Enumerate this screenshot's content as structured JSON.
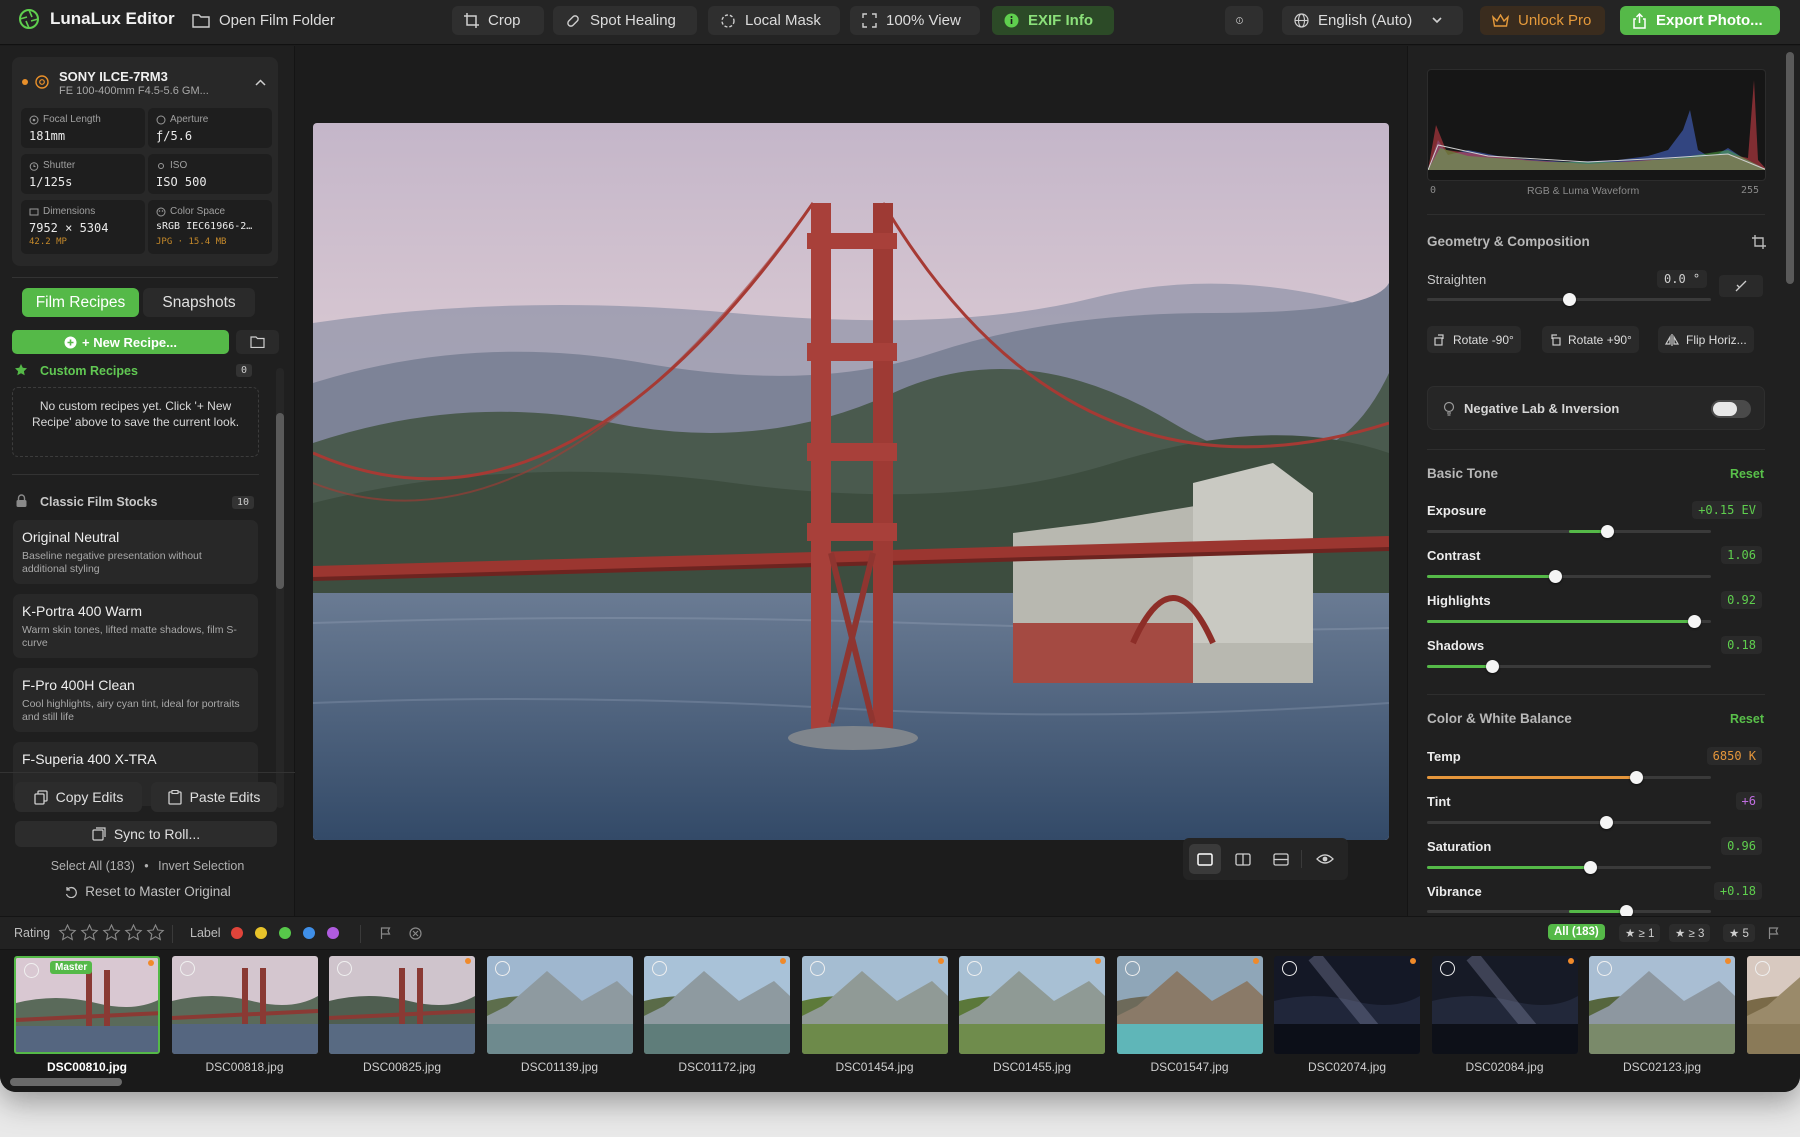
{
  "app": {
    "name": "LunaLux Editor"
  },
  "toolbar": {
    "open_folder": "Open Film Folder",
    "crop": "Crop",
    "spot_healing": "Spot Healing",
    "local_mask": "Local Mask",
    "view": "100% View",
    "exif": "EXIF Info",
    "language": "English (Auto)",
    "unlock": "Unlock Pro",
    "export": "Export Photo..."
  },
  "camera": {
    "model": "SONY ILCE-7RM3",
    "lens": "FE 100-400mm F4.5-5.6 GM...",
    "exif": {
      "focal_label": "Focal Length",
      "focal": "181mm",
      "aperture_label": "Aperture",
      "aperture": "ƒ/5.6",
      "shutter_label": "Shutter",
      "shutter": "1/125s",
      "iso_label": "ISO",
      "iso": "ISO 500",
      "dim_label": "Dimensions",
      "dim": "7952 × 5304",
      "mp": "42.2 MP",
      "cs_label": "Color Space",
      "cs": "sRGB IEC61966-2…",
      "file": "JPG · 15.4 MB"
    }
  },
  "left": {
    "tab_recipes": "Film Recipes",
    "tab_snapshots": "Snapshots",
    "new_recipe": "+ New Recipe...",
    "custom_title": "Custom Recipes",
    "custom_count": "0",
    "custom_empty": "No custom recipes yet. Click '+ New Recipe' above to save the current look.",
    "classic_title": "Classic Film Stocks",
    "classic_count": "10",
    "recipes": [
      {
        "title": "Original Neutral",
        "desc": "Baseline negative presentation without additional styling"
      },
      {
        "title": "K-Portra 400 Warm",
        "desc": "Warm skin tones, lifted matte shadows, film S-curve"
      },
      {
        "title": "F-Pro 400H Clean",
        "desc": "Cool highlights, airy cyan tint, ideal for portraits and still life"
      },
      {
        "title": "F-Superia 400 X-TRA",
        "desc": ""
      }
    ],
    "copy_edits": "Copy Edits",
    "paste_edits": "Paste Edits",
    "sync": "Sync to Roll...",
    "select_all": "Select All (183)",
    "invert": "Invert Selection",
    "reset_master": "Reset to Master Original"
  },
  "right": {
    "histogram_min": "0",
    "histogram_label": "RGB & Luma Waveform",
    "histogram_max": "255",
    "geometry_title": "Geometry & Composition",
    "straighten_label": "Straighten",
    "straighten_value": "0.0 °",
    "straighten_level": 0.5,
    "rotate_left": "Rotate -90°",
    "rotate_right": "Rotate +90°",
    "flip": "Flip Horiz...",
    "negative_lab": "Negative Lab & Inversion",
    "basic_title": "Basic Tone",
    "color_title": "Color & White Balance",
    "reset": "Reset",
    "exposure": {
      "label": "Exposure",
      "value": "+0.15 EV",
      "level": 0.635
    },
    "contrast": {
      "label": "Contrast",
      "value": "1.06",
      "level": 0.45
    },
    "highlights": {
      "label": "Highlights",
      "value": "0.92",
      "level": 0.94
    },
    "shadows": {
      "label": "Shadows",
      "value": "0.18",
      "level": 0.23
    },
    "temp": {
      "label": "Temp",
      "value": "6850 K",
      "level": 0.735
    },
    "tint": {
      "label": "Tint",
      "value": "+6",
      "level": 0.63
    },
    "saturation": {
      "label": "Saturation",
      "value": "0.96",
      "level": 0.575
    },
    "vibrance": {
      "label": "Vibrance",
      "value": "+0.18",
      "level": 0.7
    }
  },
  "filter": {
    "rating": "Rating",
    "label": "Label",
    "label_colors": [
      "#e0443a",
      "#e8c32a",
      "#57c84a",
      "#3f8fe8",
      "#b05ce0"
    ],
    "all": "All (183)",
    "r1": "★ ≥ 1",
    "r3": "★ ≥ 3",
    "r5": "★ 5"
  },
  "filmstrip": {
    "master": "Master",
    "files": [
      "DSC00810.jpg",
      "DSC00818.jpg",
      "DSC00825.jpg",
      "DSC01139.jpg",
      "DSC01172.jpg",
      "DSC01454.jpg",
      "DSC01455.jpg",
      "DSC01547.jpg",
      "DSC02074.jpg",
      "DSC02084.jpg",
      "DSC02123.jpg",
      "DSC"
    ]
  }
}
